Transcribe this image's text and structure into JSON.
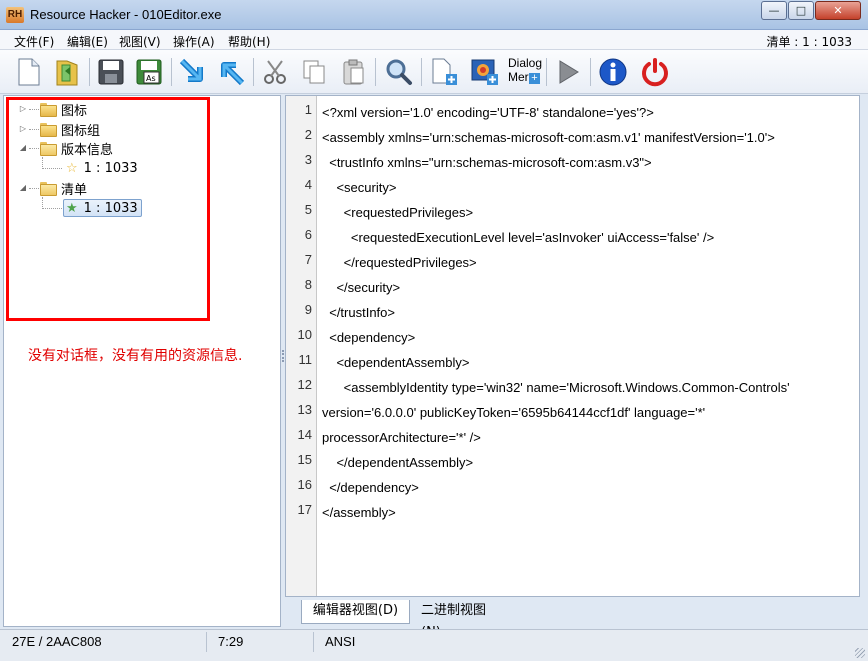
{
  "window": {
    "app_label": "RH",
    "title": "Resource Hacker - 010Editor.exe"
  },
  "menu": {
    "items": [
      "文件(F)",
      "编辑(E)",
      "视图(V)",
      "操作(A)",
      "帮助(H)"
    ],
    "right_info": "清单 : 1 : 1033"
  },
  "toolbar": {
    "dialog_merge_line1": "Dialog",
    "dialog_merge_line2": "Mer"
  },
  "tree": {
    "nodes": [
      {
        "label": "图标"
      },
      {
        "label": "图标组"
      },
      {
        "label": "版本信息"
      },
      {
        "label": "1 : 1033"
      },
      {
        "label": "清单"
      },
      {
        "label": "1 : 1033"
      }
    ]
  },
  "annotation": {
    "text": "没有对话框，没有有用的资源信息."
  },
  "editor": {
    "line_numbers": [
      "1",
      "2",
      "3",
      "4",
      "5",
      "6",
      "7",
      "8",
      "9",
      "10",
      "11",
      "12",
      "13",
      "14",
      "15",
      "16",
      "17"
    ],
    "lines": [
      "<?xml version='1.0' encoding='UTF-8' standalone='yes'?>",
      "<assembly xmlns='urn:schemas-microsoft-com:asm.v1' manifestVersion='1.0'>",
      "  <trustInfo xmlns=\"urn:schemas-microsoft-com:asm.v3\">",
      "    <security>",
      "      <requestedPrivileges>",
      "        <requestedExecutionLevel level='asInvoker' uiAccess='false' />",
      "      </requestedPrivileges>",
      "    </security>",
      "  </trustInfo>",
      "  <dependency>",
      "    <dependentAssembly>",
      "      <assemblyIdentity type='win32' name='Microsoft.Windows.Common-Controls'",
      "version='6.0.0.0' publicKeyToken='6595b64144ccf1df' language='*'",
      "processorArchitecture='*' />",
      "    </dependentAssembly>",
      "  </dependency>",
      "</assembly>"
    ]
  },
  "tabs": {
    "editor_view": "编辑器视图(D)",
    "binary_view": "二进制视图(N)"
  },
  "status": {
    "offset": "27E / 2AAC808",
    "position": "7:29",
    "encoding": "ANSI"
  }
}
